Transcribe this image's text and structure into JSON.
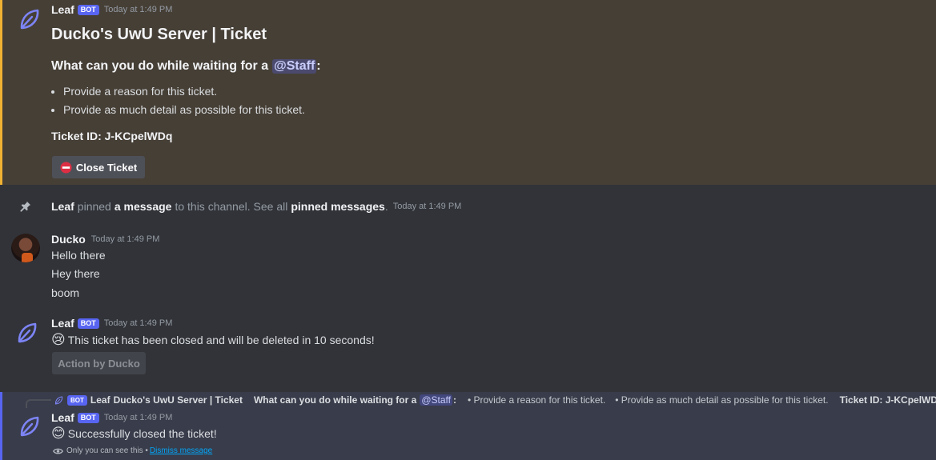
{
  "colors": {
    "highlight_bg": "#463f36",
    "highlight_bar": "#f0b232",
    "ephemeral_bg": "#393c4a",
    "ephemeral_bar": "#5865f2",
    "link": "#00a8fc"
  },
  "bot_tag": "BOT",
  "msg1": {
    "author": "Leaf",
    "timestamp": "Today at 1:49 PM",
    "title": "Ducko's UwU Server | Ticket",
    "subtitle_prefix": "What can you do while waiting for a",
    "mention": "@Staff",
    "subtitle_suffix": ":",
    "bullets": [
      "Provide a reason for this ticket.",
      "Provide as much detail as possible for this ticket."
    ],
    "ticket_id": "Ticket ID: J-KCpelWDq",
    "button_label": "Close Ticket"
  },
  "pin": {
    "author": "Leaf",
    "text1": "pinned",
    "link1": "a message",
    "text2": "to this channel. See all",
    "link2": "pinned messages",
    "text3": ".",
    "timestamp": "Today at 1:49 PM"
  },
  "msg2": {
    "author": "Ducko",
    "timestamp": "Today at 1:49 PM",
    "lines": [
      "Hello there",
      "Hey there",
      "boom"
    ]
  },
  "msg3": {
    "author": "Leaf",
    "timestamp": "Today at 1:49 PM",
    "text": "This ticket has been closed and will be deleted in 10 seconds!",
    "emoji": "😢",
    "button_label": "Action by Ducko"
  },
  "msg4": {
    "reply": {
      "author": "Leaf",
      "title": "Ducko's UwU Server | Ticket",
      "subtitle_prefix": "What can you do while waiting for a",
      "mention": "@Staff",
      "subtitle_suffix": ":",
      "bullet1": "• Provide a reason for this ticket.",
      "bullet2": "• Provide as much detail as possible for this ticket.",
      "ticket_id": "Ticket ID: J-KCpelWDq"
    },
    "author": "Leaf",
    "timestamp": "Today at 1:49 PM",
    "emoji": "😊",
    "text": "Successfully closed the ticket!",
    "only_you": "Only you can see this •",
    "dismiss": "Dismiss message"
  }
}
